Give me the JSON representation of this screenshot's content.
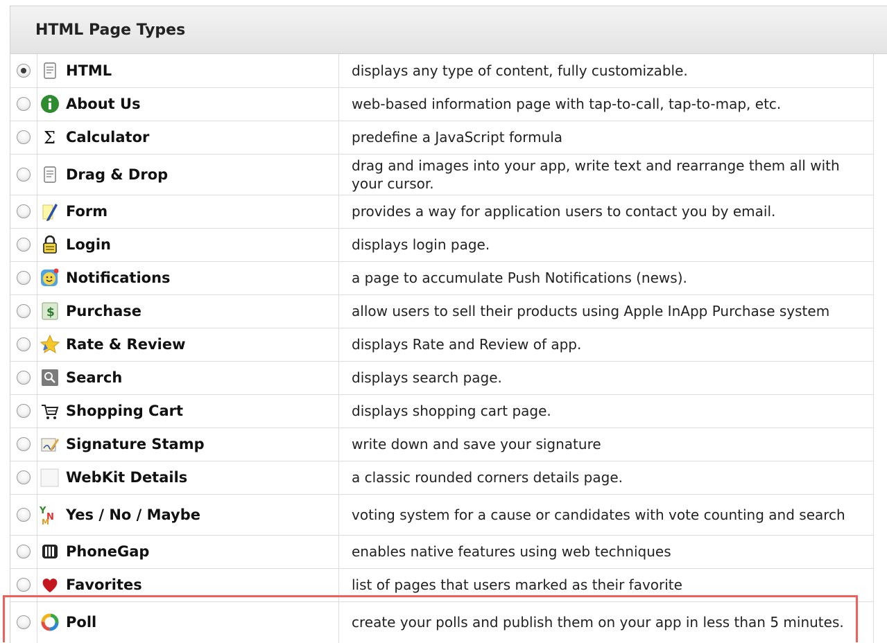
{
  "header": {
    "title": "HTML Page Types"
  },
  "rows": [
    {
      "label": "HTML",
      "desc": "displays any type of content, fully customizable.",
      "checked": true,
      "icon": "html-icon"
    },
    {
      "label": "About Us",
      "desc": "web-based information page with tap-to-call, tap-to-map, etc.",
      "icon": "info-icon"
    },
    {
      "label": "Calculator",
      "desc": "predefine a JavaScript formula",
      "icon": "sigma-icon"
    },
    {
      "label": "Drag & Drop",
      "desc": "drag and images into your app, write text and rearrange them all with your cursor.",
      "icon": "document-icon"
    },
    {
      "label": "Form",
      "desc": "provides a way for application users to contact you by email.",
      "icon": "pencil-icon"
    },
    {
      "label": "Login",
      "desc": "displays login page.",
      "icon": "lock-icon"
    },
    {
      "label": "Notifications",
      "desc": "a page to accumulate Push Notifications (news).",
      "icon": "smiley-icon"
    },
    {
      "label": "Purchase",
      "desc": "allow users to sell their products using Apple InApp Purchase system",
      "icon": "dollar-icon"
    },
    {
      "label": "Rate & Review",
      "desc": "displays Rate and Review of app.",
      "icon": "star-icon"
    },
    {
      "label": "Search",
      "desc": "displays search page.",
      "icon": "search-icon"
    },
    {
      "label": "Shopping Cart",
      "desc": "displays shopping cart page.",
      "icon": "cart-icon"
    },
    {
      "label": "Signature Stamp",
      "desc": "write down and save your signature",
      "icon": "signature-icon"
    },
    {
      "label": "WebKit Details",
      "desc": "a classic rounded corners details page.",
      "icon": "blank-page-icon"
    },
    {
      "label": "Yes / No / Maybe",
      "desc": "voting system for a cause or candidates with vote counting and search",
      "icon": "vote-icon"
    },
    {
      "label": "PhoneGap",
      "desc": "enables native features using web techniques",
      "icon": "phonegap-icon"
    },
    {
      "label": "Favorites",
      "desc": "list of pages that users marked as their favorite",
      "icon": "heart-icon"
    },
    {
      "label": "Poll",
      "desc": "create your polls and publish them on your app in less than 5 minutes.",
      "icon": "poll-icon"
    }
  ],
  "colors": {
    "highlight": "#f0605a",
    "header_bg": "#e9e9e9"
  }
}
